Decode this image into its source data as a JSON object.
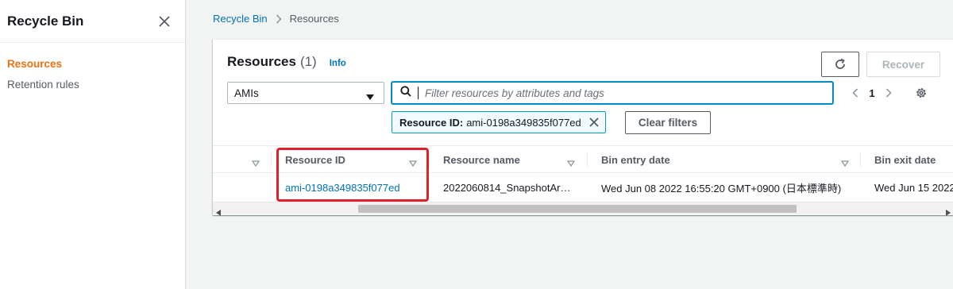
{
  "sidebar": {
    "title": "Recycle Bin",
    "items": [
      {
        "label": "Resources",
        "active": true
      },
      {
        "label": "Retention rules",
        "active": false
      }
    ]
  },
  "breadcrumb": {
    "items": [
      "Recycle Bin",
      "Resources"
    ]
  },
  "panel": {
    "title": "Resources",
    "count": "(1)",
    "info_label": "Info",
    "recover_label": "Recover",
    "clear_filters_label": "Clear filters"
  },
  "filter": {
    "resource_type": "AMIs",
    "search_placeholder": "Filter resources by attributes and tags",
    "token_key": "Resource ID:",
    "token_value": "ami-0198a349835f077ed"
  },
  "pagination": {
    "current_page": "1"
  },
  "table": {
    "columns": [
      "Resource ID",
      "Resource name",
      "Bin entry date",
      "Bin exit date"
    ],
    "rows": [
      {
        "resource_id": "ami-0198a349835f077ed",
        "resource_name": "2022060814_SnapshotAr…",
        "bin_entry_date": "Wed Jun 08 2022 16:55:20 GMT+0900 (日本標準時)",
        "bin_exit_date": "Wed Jun 15 2022"
      }
    ]
  },
  "colors": {
    "accent_orange": "#ec7211",
    "link_blue": "#0073bb",
    "highlight_red": "#e0202a"
  }
}
